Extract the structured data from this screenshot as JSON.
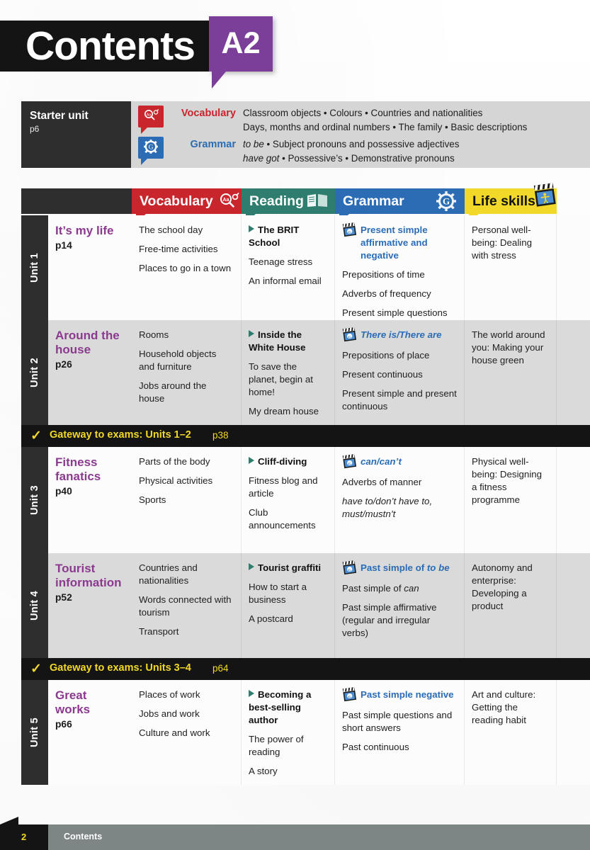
{
  "header": {
    "title": "Contents",
    "level_badge": "A2"
  },
  "starter": {
    "title": "Starter unit",
    "page": "p6",
    "rows": [
      {
        "icon": "vocabulary-magnifier-icon",
        "icon_glyph": "⌕",
        "label": "Vocabulary",
        "color": "#C8262C",
        "line1": "Classroom objects • Colours • Countries and nationalities",
        "line2": "Days, months and ordinal numbers • The family • Basic descriptions"
      },
      {
        "icon": "grammar-gear-icon",
        "icon_glyph": "G",
        "label": "Grammar",
        "color": "#2B6CB5",
        "line1": "to be • Subject pronouns and possessive adjectives",
        "line2": "have got • Possessive’s • Demonstrative pronouns"
      }
    ]
  },
  "columns": [
    {
      "key": "blank",
      "label": "",
      "color": "#2e2e2e",
      "icon": ""
    },
    {
      "key": "vocabulary",
      "label": "Vocabulary",
      "color": "#C8262C",
      "icon": "magnifier-icon"
    },
    {
      "key": "reading",
      "label": "Reading",
      "color": "#2E7D6E",
      "icon": "open-book-icon"
    },
    {
      "key": "grammar",
      "label": "Grammar",
      "color": "#2B6CB5",
      "icon": "gear-icon"
    },
    {
      "key": "life_skills",
      "label": "Life skills",
      "color": "#F2D829",
      "icon": "clapperboard-icon"
    }
  ],
  "units": [
    {
      "unit_label": "Unit 1",
      "title": "It’s my life",
      "page": "p14",
      "vocabulary": [
        "The school day",
        "Free-time activities",
        "Places to go in a town"
      ],
      "reading_head": "The BRIT School",
      "reading": [
        "Teenage stress",
        "An informal email"
      ],
      "grammar_head": "Present simple affirmative and negative",
      "grammar_head_italic": "",
      "grammar": [
        "Prepositions of time",
        "Adverbs of frequency",
        "Present simple questions"
      ],
      "life_skills": "Personal well-being: Dealing with stress"
    },
    {
      "unit_label": "Unit 2",
      "title": "Around the house",
      "page": "p26",
      "vocabulary": [
        "Rooms",
        "Household objects and furniture",
        "Jobs around the house"
      ],
      "reading_head": "Inside the White House",
      "reading": [
        "To save the planet, begin at home!",
        "My dream house"
      ],
      "grammar_head": "There is/There are",
      "grammar_head_italic": "italic",
      "grammar": [
        "Prepositions of place",
        "Present continuous",
        "Present simple and present continuous"
      ],
      "life_skills": "The world around you: Making your house green"
    },
    {
      "unit_label": "Unit 3",
      "title": "Fitness fanatics",
      "page": "p40",
      "vocabulary": [
        "Parts of the body",
        "Physical activities",
        "Sports"
      ],
      "reading_head": "Cliff-diving",
      "reading": [
        "Fitness blog and article",
        "Club announcements"
      ],
      "grammar_head": "can/can’t",
      "grammar_head_italic": "italic",
      "grammar": [
        "Adverbs of manner",
        "have to/don’t have to, must/mustn’t"
      ],
      "grammar_italic_indexes": [
        1
      ],
      "life_skills": "Physical well-being: Designing a fitness programme"
    },
    {
      "unit_label": "Unit 4",
      "title": "Tourist information",
      "page": "p52",
      "vocabulary": [
        "Countries and nationalities",
        "Words connected with tourism",
        "Transport"
      ],
      "reading_head": "Tourist graffiti",
      "reading": [
        "How to start a business",
        "A postcard"
      ],
      "grammar_head": "Past simple of to be",
      "grammar_head_italic": "partial",
      "grammar": [
        "Past simple of can",
        "Past simple affirmative (regular and irregular verbs)"
      ],
      "life_skills": "Autonomy and enterprise: Developing a product"
    },
    {
      "unit_label": "Unit 5",
      "title": "Great works",
      "page": "p66",
      "vocabulary": [
        "Places of work",
        "Jobs and work",
        "Culture and work"
      ],
      "reading_head": "Becoming a best-selling author",
      "reading": [
        "The power of reading",
        "A story"
      ],
      "grammar_head": "Past simple negative",
      "grammar_head_italic": "",
      "grammar": [
        "Past simple questions and short answers",
        "Past continuous"
      ],
      "life_skills": "Art and culture: Getting the reading habit"
    }
  ],
  "gateways": [
    {
      "check": "✓",
      "label": "Gateway to exams: Units 1–2",
      "page": "p38"
    },
    {
      "check": "✓",
      "label": "Gateway to exams: Units 3–4",
      "page": "p64"
    }
  ],
  "footer": {
    "page_number": "2",
    "label": "Contents"
  }
}
